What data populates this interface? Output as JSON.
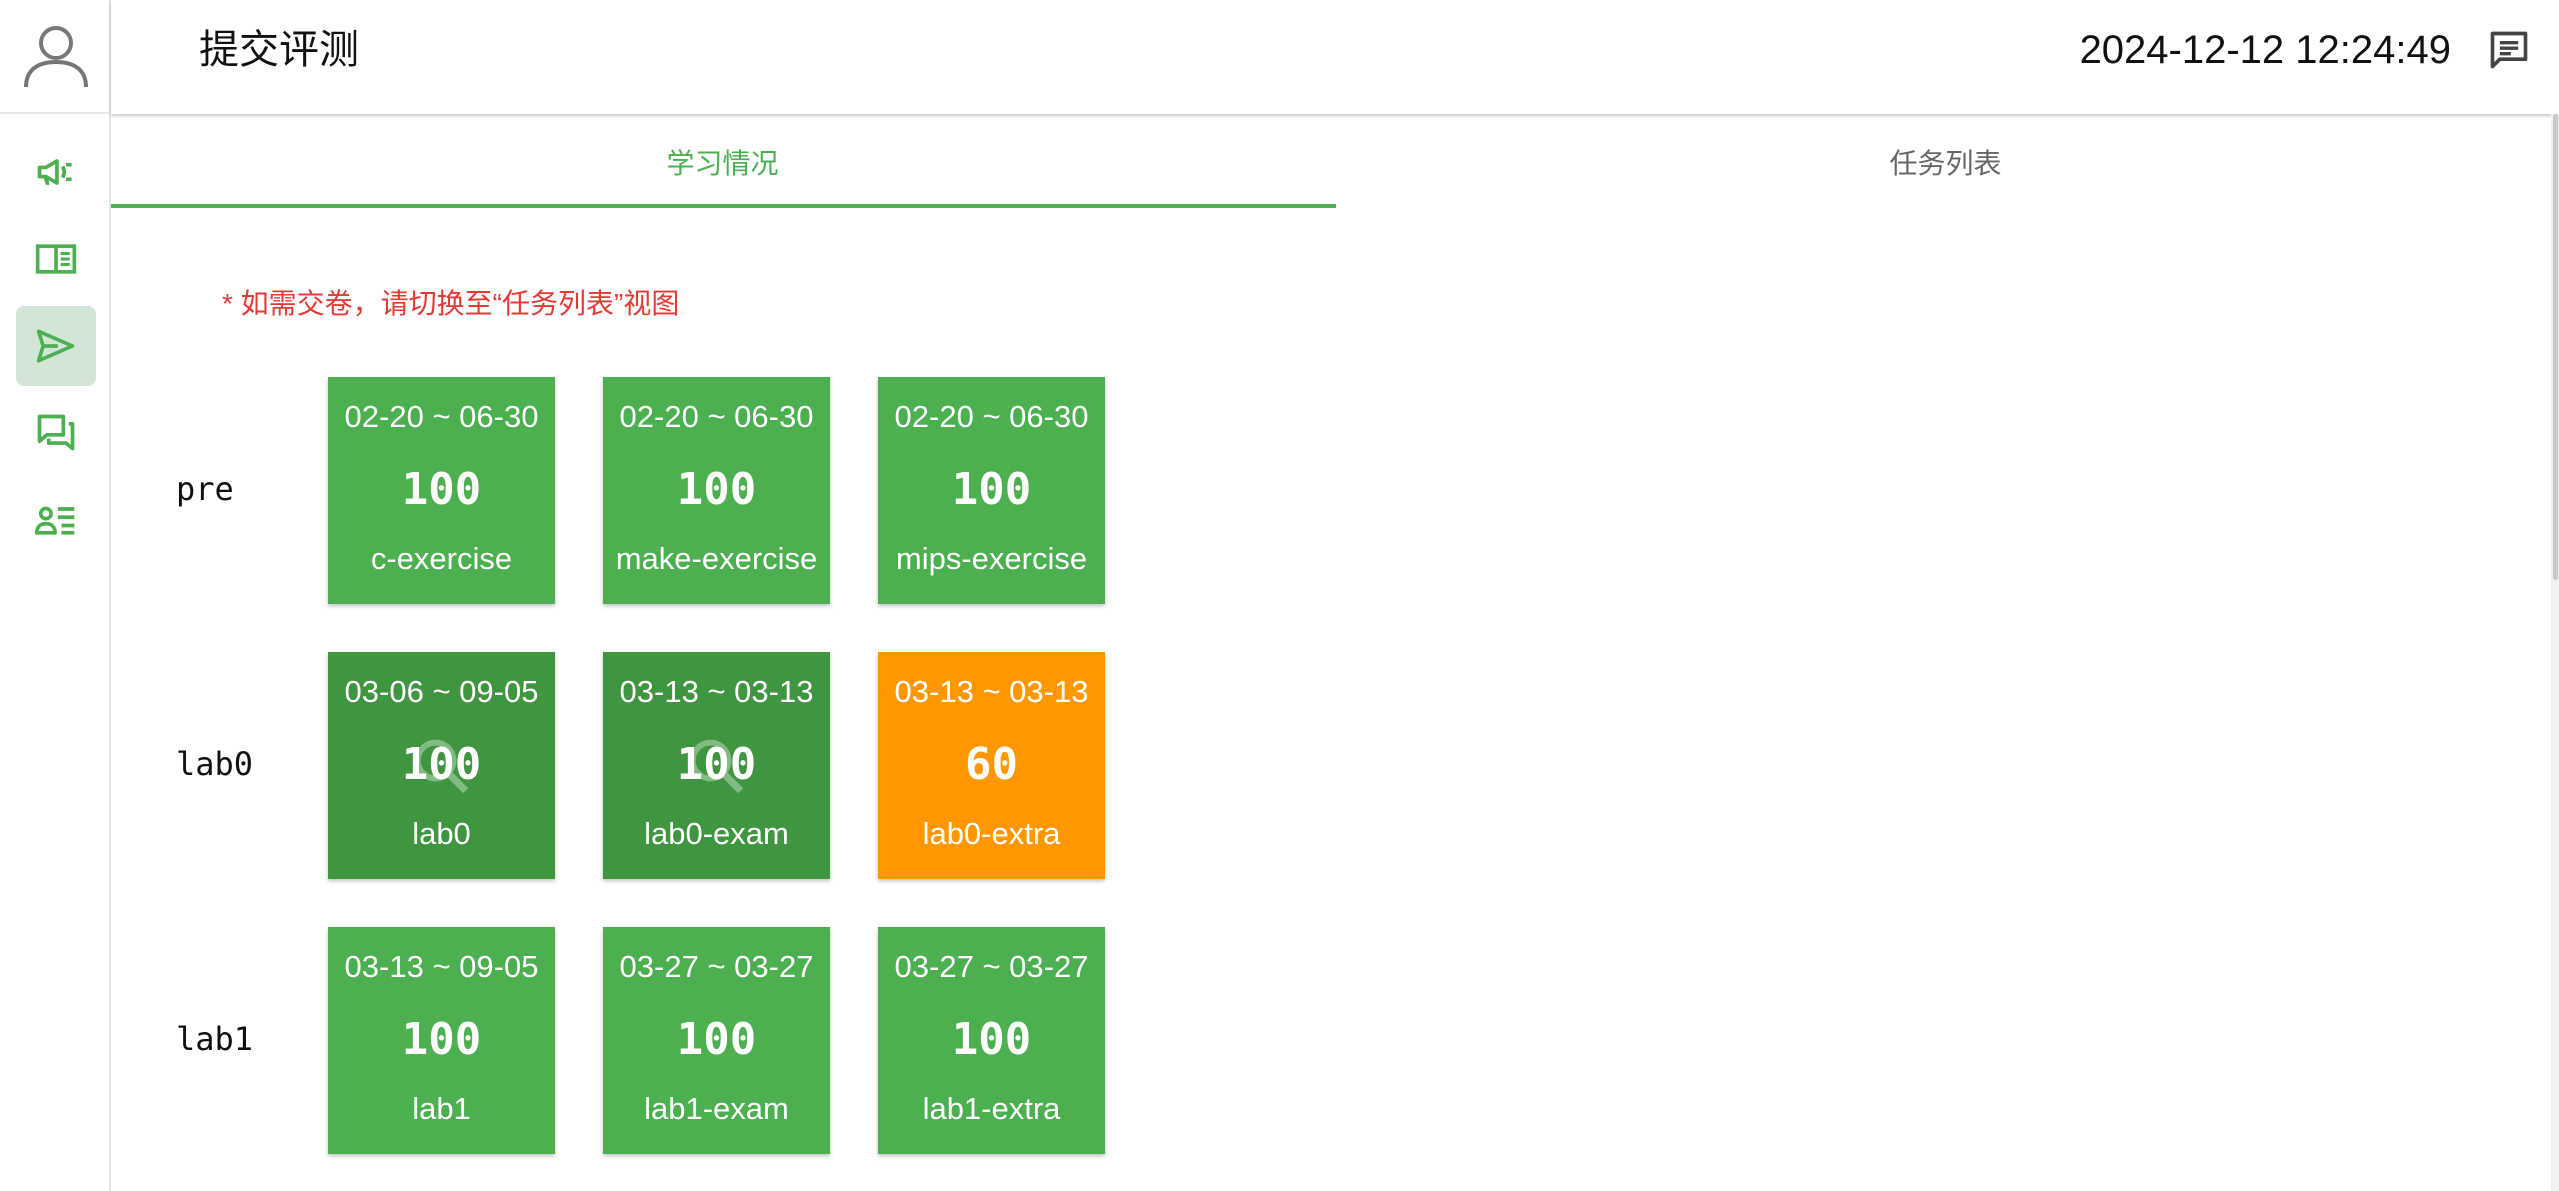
{
  "header": {
    "title": "提交评测",
    "datetime": "2024-12-12 12:24:49"
  },
  "sidebar": {
    "items": [
      {
        "icon": "megaphone-icon",
        "active": false
      },
      {
        "icon": "book-icon",
        "active": false
      },
      {
        "icon": "send-icon",
        "active": true
      },
      {
        "icon": "forum-icon",
        "active": false
      },
      {
        "icon": "person-list-icon",
        "active": false
      }
    ]
  },
  "tabs": [
    {
      "label": "学习情况",
      "active": true
    },
    {
      "label": "任务列表",
      "active": false
    }
  ],
  "notice": "* 如需交卷，请切换至“任务列表”视图",
  "colors": {
    "accent": "#4caf50",
    "card_pass": "#4caf50",
    "card_pass_reviewed": "#3f9540",
    "card_partial": "#ff9800",
    "notice": "#e53935"
  },
  "groups": [
    {
      "label": "pre",
      "cards": [
        {
          "date": "02-20 ~ 06-30",
          "score": "100",
          "name": "c-exercise",
          "status": "pass"
        },
        {
          "date": "02-20 ~ 06-30",
          "score": "100",
          "name": "make-exercise",
          "status": "pass"
        },
        {
          "date": "02-20 ~ 06-30",
          "score": "100",
          "name": "mips-exercise",
          "status": "pass"
        }
      ]
    },
    {
      "label": "lab0",
      "cards": [
        {
          "date": "03-06 ~ 09-05",
          "score": "100",
          "name": "lab0",
          "status": "reviewed"
        },
        {
          "date": "03-13 ~ 03-13",
          "score": "100",
          "name": "lab0-exam",
          "status": "reviewed"
        },
        {
          "date": "03-13 ~ 03-13",
          "score": "60",
          "name": "lab0-extra",
          "status": "partial"
        }
      ]
    },
    {
      "label": "lab1",
      "cards": [
        {
          "date": "03-13 ~ 09-05",
          "score": "100",
          "name": "lab1",
          "status": "pass"
        },
        {
          "date": "03-27 ~ 03-27",
          "score": "100",
          "name": "lab1-exam",
          "status": "pass"
        },
        {
          "date": "03-27 ~ 03-27",
          "score": "100",
          "name": "lab1-extra",
          "status": "pass"
        }
      ]
    }
  ]
}
